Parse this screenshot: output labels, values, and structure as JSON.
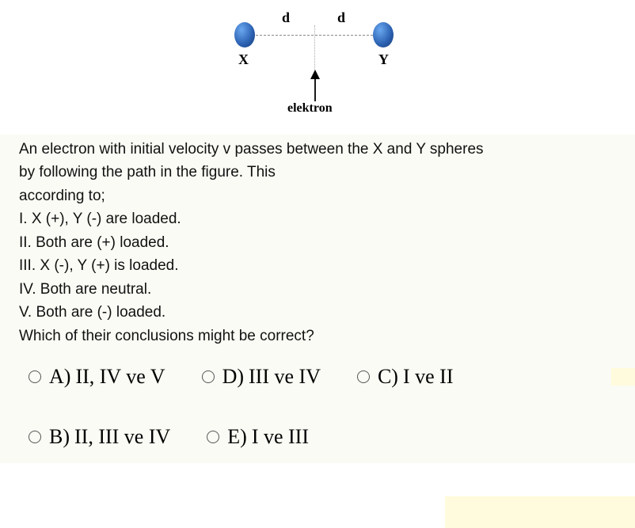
{
  "diagram": {
    "label_x": "X",
    "label_y": "Y",
    "label_d1": "d",
    "label_d2": "d",
    "label_arrow": "elektron"
  },
  "question": {
    "lines": [
      "An electron with initial velocity v passes between the X and Y spheres",
      "by following the path in the figure. This",
      "according to;",
      "I. X (+), Y (-) are loaded.",
      "II. Both are (+) loaded.",
      "III. X (-), Y (+) is loaded.",
      "IV. Both are neutral.",
      "V. Both are (-) loaded.",
      "Which of their conclusions might be correct?"
    ]
  },
  "answers": {
    "a": {
      "label": "A)",
      "text": "II, IV ve V"
    },
    "b": {
      "label": "B)",
      "text": "II, III ve IV"
    },
    "c": {
      "label": "C)",
      "text": "I ve II"
    },
    "d": {
      "label": "D)",
      "text": "III ve IV"
    },
    "e": {
      "label": "E)",
      "text": "I ve III"
    }
  }
}
